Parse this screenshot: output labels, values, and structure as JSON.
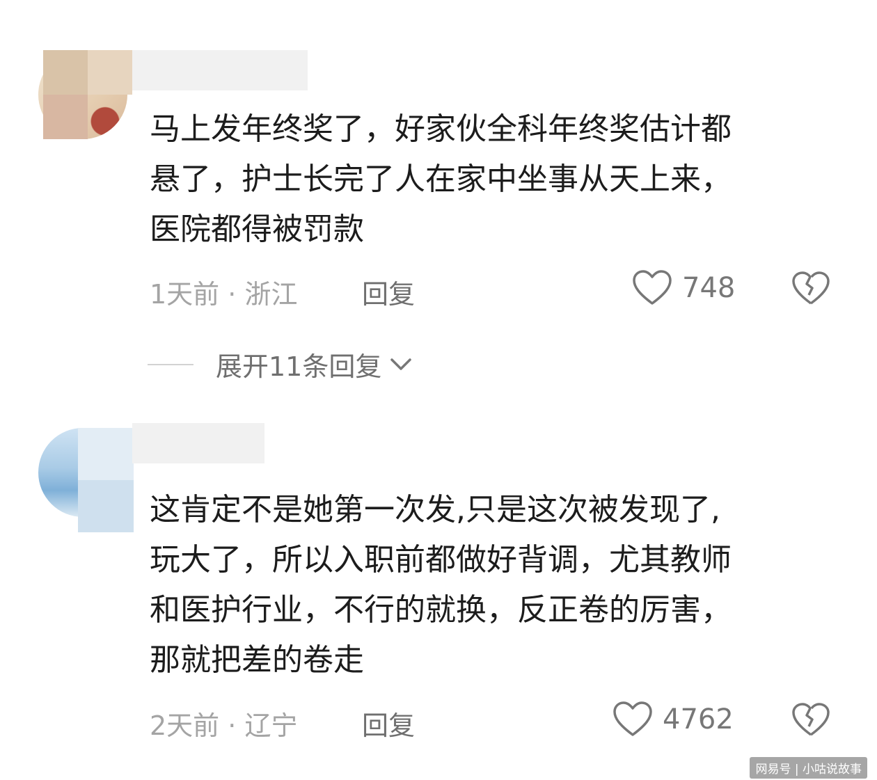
{
  "comments": [
    {
      "text": "马上发年终奖了，好家伙全科年终奖估计都\n悬了，护士长完了人在家中坐事从天上来，\n医院都得被罚款",
      "time": "1天前",
      "location": "浙江",
      "reply_label": "回复",
      "likes": "748",
      "expand_label": "展开11条回复"
    },
    {
      "text": "这肯定不是她第一次发,只是这次被发现了,\n玩大了，所以入职前都做好背调，尤其教师\n和医护行业，不行的就换，反正卷的厉害，\n那就把差的卷走",
      "time": "2天前",
      "location": "辽宁",
      "reply_label": "回复",
      "likes": "4762"
    }
  ],
  "meta_separator": " · ",
  "watermark": "网易号 | 小咕说故事",
  "icons": {
    "like": "heart-outline-icon",
    "dislike": "broken-heart-icon",
    "expand": "chevron-down-icon"
  }
}
